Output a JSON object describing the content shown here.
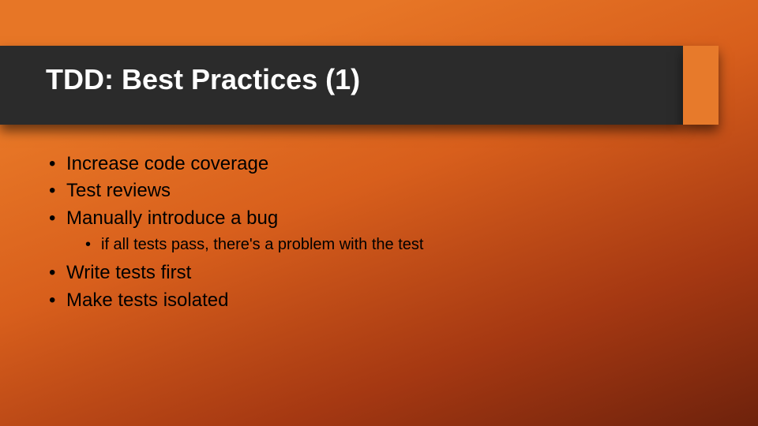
{
  "slide": {
    "title": "TDD: Best Practices (1)",
    "bullets": [
      {
        "text": "Increase code coverage"
      },
      {
        "text": "Test reviews"
      },
      {
        "text": "Manually introduce a bug",
        "sub": [
          {
            "text": "if all tests pass, there's a problem with the test"
          }
        ]
      },
      {
        "text": "Write tests first"
      },
      {
        "text": "Make tests isolated"
      }
    ]
  }
}
